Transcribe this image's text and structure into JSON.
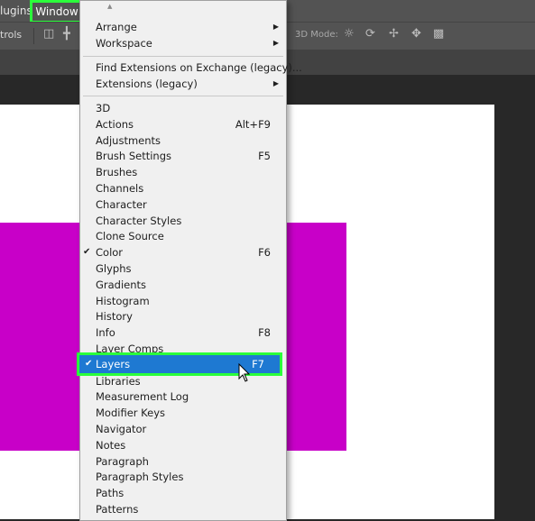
{
  "menubar": {
    "plugins_label": "lugins",
    "window_label": "Window"
  },
  "optionsbar": {
    "controls_label": "trols",
    "mode3d_label": "3D Mode:"
  },
  "menu": {
    "arrange": "Arrange",
    "workspace": "Workspace",
    "find_extensions": "Find Extensions on Exchange (legacy)...",
    "extensions": "Extensions (legacy)",
    "items": [
      {
        "label": "3D",
        "shortcut": ""
      },
      {
        "label": "Actions",
        "shortcut": "Alt+F9"
      },
      {
        "label": "Adjustments",
        "shortcut": ""
      },
      {
        "label": "Brush Settings",
        "shortcut": "F5"
      },
      {
        "label": "Brushes",
        "shortcut": ""
      },
      {
        "label": "Channels",
        "shortcut": ""
      },
      {
        "label": "Character",
        "shortcut": ""
      },
      {
        "label": "Character Styles",
        "shortcut": ""
      },
      {
        "label": "Clone Source",
        "shortcut": ""
      },
      {
        "label": "Color",
        "shortcut": "F6"
      },
      {
        "label": "Glyphs",
        "shortcut": ""
      },
      {
        "label": "Gradients",
        "shortcut": ""
      },
      {
        "label": "Histogram",
        "shortcut": ""
      },
      {
        "label": "History",
        "shortcut": ""
      },
      {
        "label": "Info",
        "shortcut": "F8"
      },
      {
        "label": "Layer Comps",
        "shortcut": ""
      },
      {
        "label": "Layers",
        "shortcut": "F7"
      },
      {
        "label": "Libraries",
        "shortcut": ""
      },
      {
        "label": "Measurement Log",
        "shortcut": ""
      },
      {
        "label": "Modifier Keys",
        "shortcut": ""
      },
      {
        "label": "Navigator",
        "shortcut": ""
      },
      {
        "label": "Notes",
        "shortcut": ""
      },
      {
        "label": "Paragraph",
        "shortcut": ""
      },
      {
        "label": "Paragraph Styles",
        "shortcut": ""
      },
      {
        "label": "Paths",
        "shortcut": ""
      },
      {
        "label": "Patterns",
        "shortcut": ""
      }
    ],
    "check_mark": "✔"
  },
  "colors": {
    "highlight": "#1e79d2",
    "annotation": "#2bff3b",
    "canvas_fill": "#c800c8"
  }
}
